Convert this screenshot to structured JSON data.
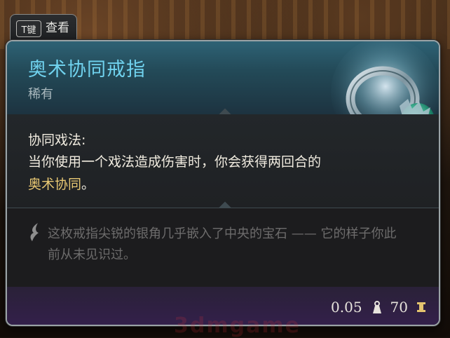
{
  "hint": {
    "key": "T键",
    "label": "查看"
  },
  "item": {
    "name": "奥术协同戒指",
    "rarity": "稀有",
    "passive_name": "协同戏法:",
    "passive_desc_before": "当你使用一个戏法造成伤害时，你会获得两回合的",
    "passive_keyword": "奥术协同",
    "passive_desc_after": "。",
    "lore": "这枚戒指尖锐的银角几乎嵌入了中央的宝石 —— 它的样子你此前从未见识过。",
    "weight": "0.05",
    "value": "70"
  },
  "watermark": "3dmgame",
  "colors": {
    "name": "#70d2ee",
    "keyword": "#e8c873",
    "rarity": "#a9b8bd"
  },
  "icons": {
    "weight": "weight-icon",
    "gold": "gold-icon",
    "lore": "quill-icon",
    "ring": "ring-image"
  }
}
